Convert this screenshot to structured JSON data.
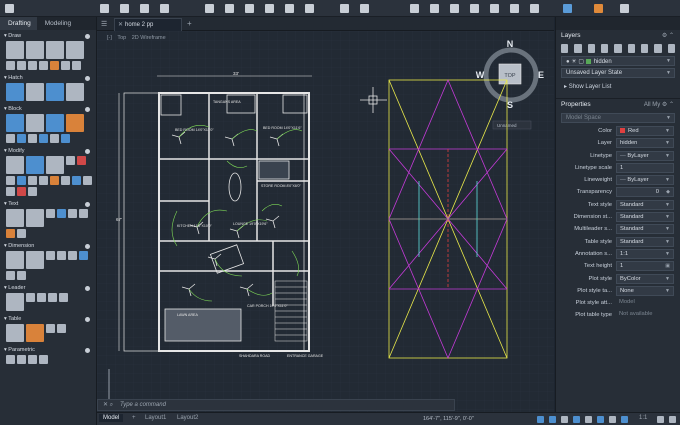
{
  "left_panel": {
    "tabs": [
      {
        "label": "Drafting"
      },
      {
        "label": "Modeling"
      }
    ],
    "sections": {
      "draw": "Draw",
      "hatch": "Hatch",
      "block": "Block",
      "modify": "Modify",
      "text": "Text",
      "dimension": "Dimension",
      "leader": "Leader",
      "table": "Table",
      "parametric": "Parametric"
    }
  },
  "file_tab": {
    "name": "home 2 pp"
  },
  "viewport": {
    "view": "Top",
    "visual_style": "2D Wireframe",
    "viewcube_face": "TOP",
    "compass": [
      "N",
      "E",
      "S",
      "W"
    ],
    "ucs_label": "Unnamed"
  },
  "drawing": {
    "overall_width": "33'",
    "overall_height": "67'",
    "rooms": [
      "TANGANS AREA",
      "BED ROOM\n14'0\"X11'0\"",
      "BED ROOM\n14'0\"X11'6\"",
      "KITCHEN\n11'6\"X10'0\"",
      "LOUNGE\n19'0\"X19'6\"",
      "STORE ROOM\n8'0\"X6'0\"",
      "CAR\nPORCH\n19'0\"X11'0\"",
      "LAWN AREA",
      "SHAHDARA ROAD",
      "ENTRANCE\nGARAGE"
    ]
  },
  "command": {
    "placeholder": "Type a command"
  },
  "status": {
    "tabs": [
      "Model",
      "Layout1",
      "Layout2"
    ],
    "coords": "164'-7\", 115'-9\", 0'-0\"",
    "scale": "1:1"
  },
  "layers": {
    "title": "Layers",
    "current_layer": "hidden",
    "layer_state": "Unsaved Layer State",
    "show_list": "Show Layer List"
  },
  "properties": {
    "title": "Properties",
    "all_label": "All",
    "my_label": "My",
    "space": "Model Space",
    "rows": [
      {
        "label": "Color",
        "value": "Red"
      },
      {
        "label": "Layer",
        "value": "hidden"
      },
      {
        "label": "Linetype",
        "value": "ByLayer"
      },
      {
        "label": "Linetype scale",
        "value": "1"
      },
      {
        "label": "Lineweight",
        "value": "ByLayer"
      },
      {
        "label": "Transparency",
        "value": "0"
      },
      {
        "label": "Text style",
        "value": "Standard"
      },
      {
        "label": "Dimension st...",
        "value": "Standard"
      },
      {
        "label": "Multileader s...",
        "value": "Standard"
      },
      {
        "label": "Table style",
        "value": "Standard"
      },
      {
        "label": "Annotation s...",
        "value": "1:1"
      },
      {
        "label": "Text height",
        "value": "1"
      },
      {
        "label": "Plot style",
        "value": "ByColor"
      },
      {
        "label": "Plot style ta...",
        "value": "None"
      },
      {
        "label": "Plot style att...",
        "value": "Model"
      },
      {
        "label": "Plot table type",
        "value": "Not available"
      }
    ]
  },
  "colors": {
    "viewport_bg": "#222a34",
    "wall": "#e6e6e6",
    "green": "#7ed957",
    "yellow": "#e9e94a",
    "magenta": "#c43ad8",
    "cyan": "#5fe0e0",
    "red": "#e04040"
  }
}
